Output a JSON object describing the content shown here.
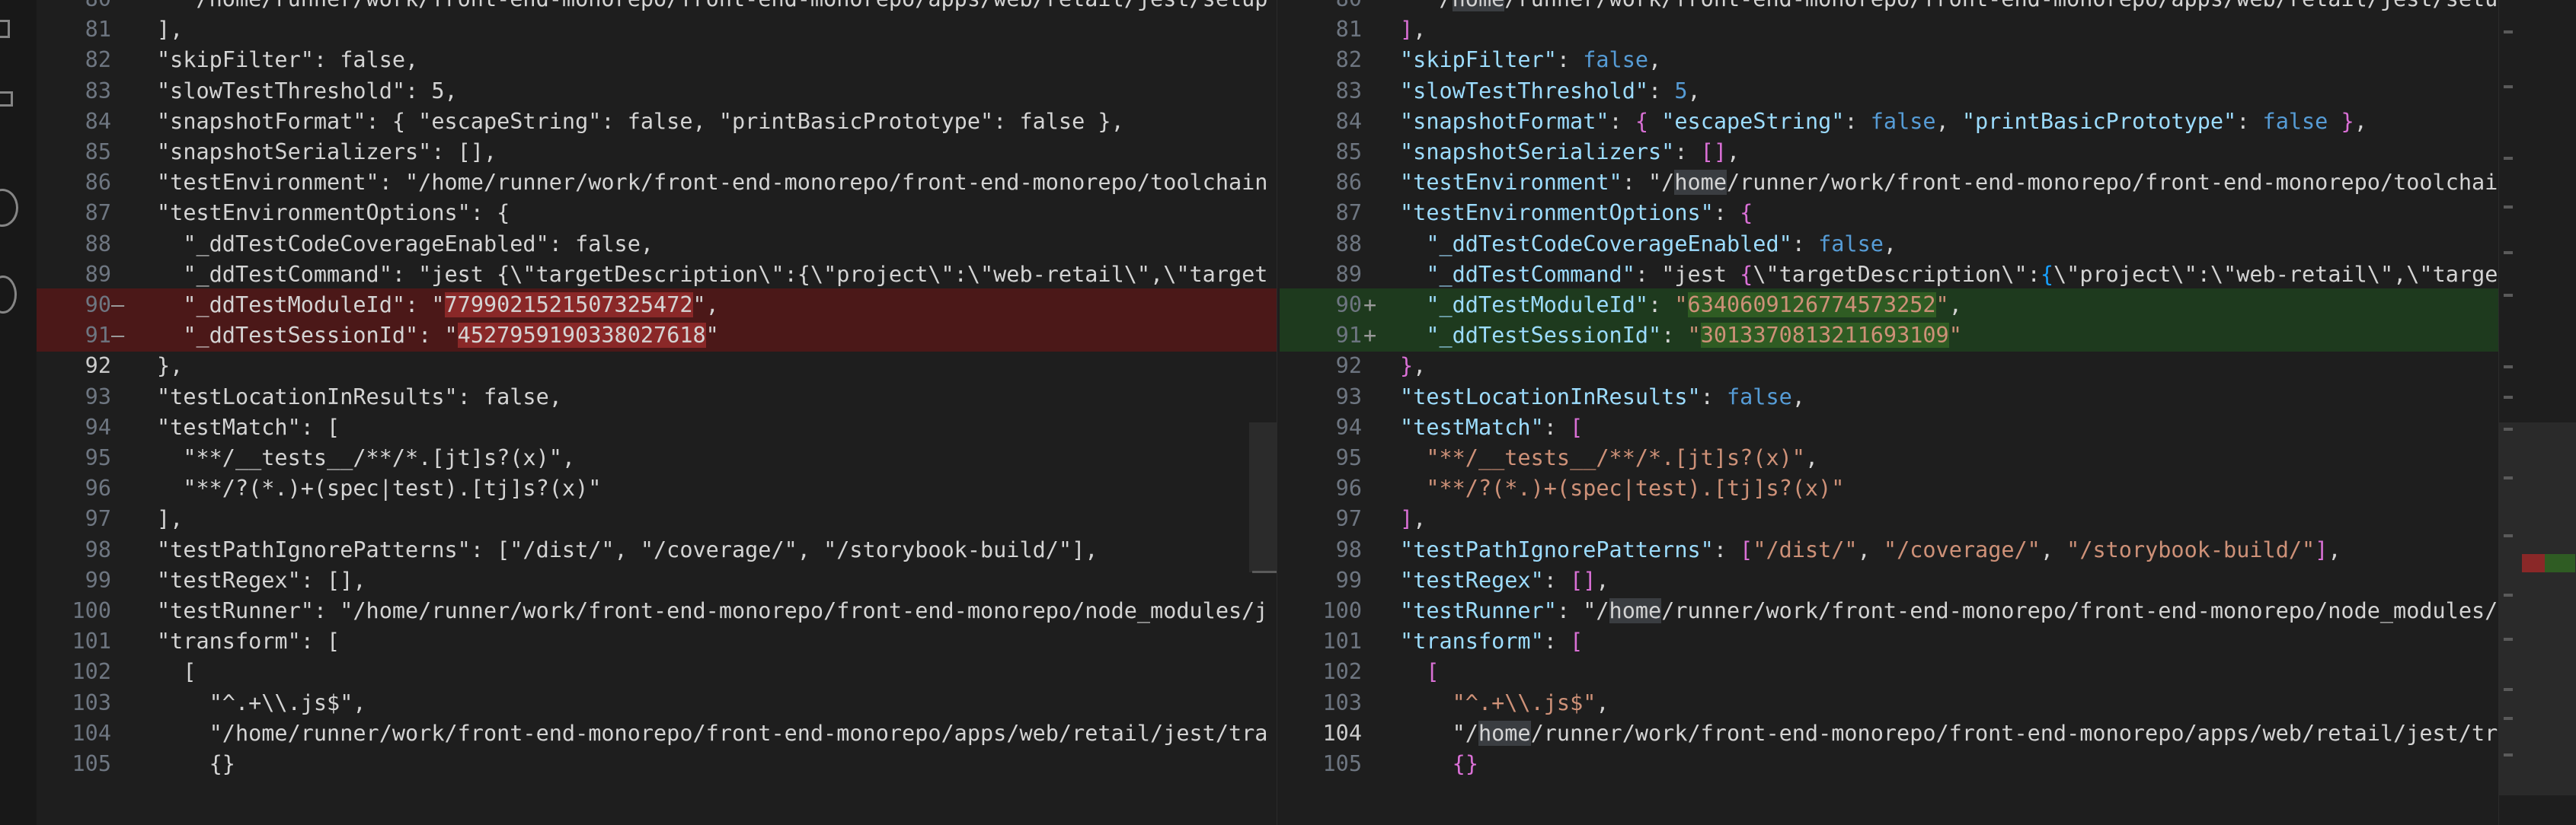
{
  "diff": {
    "left_lines": [
      {
        "num": "80",
        "marker": "",
        "type": "normal",
        "text": "  \"/home/runner/work/front-end-monorepo/front-end-monorepo/apps/web/retail/jest/setup"
      },
      {
        "num": "81",
        "marker": "",
        "type": "normal",
        "text": "],"
      },
      {
        "num": "82",
        "marker": "",
        "type": "normal",
        "text": "\"skipFilter\": false,"
      },
      {
        "num": "83",
        "marker": "",
        "type": "normal",
        "text": "\"slowTestThreshold\": 5,"
      },
      {
        "num": "84",
        "marker": "",
        "type": "normal",
        "text": "\"snapshotFormat\": { \"escapeString\": false, \"printBasicPrototype\": false },"
      },
      {
        "num": "85",
        "marker": "",
        "type": "normal",
        "text": "\"snapshotSerializers\": [],"
      },
      {
        "num": "86",
        "marker": "",
        "type": "normal",
        "text": "\"testEnvironment\": \"/home/runner/work/front-end-monorepo/front-end-monorepo/toolchain"
      },
      {
        "num": "87",
        "marker": "",
        "type": "normal",
        "text": "\"testEnvironmentOptions\": {"
      },
      {
        "num": "88",
        "marker": "",
        "type": "normal",
        "text": "  \"_ddTestCodeCoverageEnabled\": false,"
      },
      {
        "num": "89",
        "marker": "",
        "type": "normal",
        "text": "  \"_ddTestCommand\": \"jest {\\\"targetDescription\\\":{\\\"project\\\":\\\"web-retail\\\",\\\"target"
      },
      {
        "num": "90",
        "marker": "—",
        "type": "removed",
        "text": "  \"_ddTestModuleId\": \"7799021521507325472\","
      },
      {
        "num": "91",
        "marker": "—",
        "type": "removed",
        "text": "  \"_ddTestSessionId\": \"4527959190338027618\""
      },
      {
        "num": "92",
        "marker": "",
        "type": "normal",
        "text": "},"
      },
      {
        "num": "93",
        "marker": "",
        "type": "normal",
        "text": "\"testLocationInResults\": false,"
      },
      {
        "num": "94",
        "marker": "",
        "type": "normal",
        "text": "\"testMatch\": ["
      },
      {
        "num": "95",
        "marker": "",
        "type": "normal",
        "text": "  \"**/__tests__/**/*.[jt]s?(x)\","
      },
      {
        "num": "96",
        "marker": "",
        "type": "normal",
        "text": "  \"**/?(*.)+(spec|test).[tj]s?(x)\""
      },
      {
        "num": "97",
        "marker": "",
        "type": "normal",
        "text": "],"
      },
      {
        "num": "98",
        "marker": "",
        "type": "normal",
        "text": "\"testPathIgnorePatterns\": [\"/dist/\", \"/coverage/\", \"/storybook-build/\"],"
      },
      {
        "num": "99",
        "marker": "",
        "type": "normal",
        "text": "\"testRegex\": [],"
      },
      {
        "num": "100",
        "marker": "",
        "type": "normal",
        "text": "\"testRunner\": \"/home/runner/work/front-end-monorepo/front-end-monorepo/node_modules/j"
      },
      {
        "num": "101",
        "marker": "",
        "type": "normal",
        "text": "\"transform\": ["
      },
      {
        "num": "102",
        "marker": "",
        "type": "normal",
        "text": "  ["
      },
      {
        "num": "103",
        "marker": "",
        "type": "normal",
        "text": "    \"^.+\\\\.js$\","
      },
      {
        "num": "104",
        "marker": "",
        "type": "normal",
        "text": "    \"/home/runner/work/front-end-monorepo/front-end-monorepo/apps/web/retail/jest/tra"
      },
      {
        "num": "105",
        "marker": "",
        "type": "normal",
        "text": "    {}"
      }
    ],
    "right_lines": [
      {
        "num": "80",
        "marker": "",
        "type": "normal",
        "text": "  \"/home/runner/work/front-end-monorepo/front-end-monorepo/apps/web/retail/jest/setup"
      },
      {
        "num": "81",
        "marker": "",
        "type": "normal",
        "text": "],"
      },
      {
        "num": "82",
        "marker": "",
        "type": "normal",
        "text": "\"skipFilter\": false,"
      },
      {
        "num": "83",
        "marker": "",
        "type": "normal",
        "text": "\"slowTestThreshold\": 5,"
      },
      {
        "num": "84",
        "marker": "",
        "type": "normal",
        "text": "\"snapshotFormat\": { \"escapeString\": false, \"printBasicPrototype\": false },"
      },
      {
        "num": "85",
        "marker": "",
        "type": "normal",
        "text": "\"snapshotSerializers\": [],"
      },
      {
        "num": "86",
        "marker": "",
        "type": "normal",
        "text": "\"testEnvironment\": \"/home/runner/work/front-end-monorepo/front-end-monorepo/toolchain"
      },
      {
        "num": "87",
        "marker": "",
        "type": "normal",
        "text": "\"testEnvironmentOptions\": {"
      },
      {
        "num": "88",
        "marker": "",
        "type": "normal",
        "text": "  \"_ddTestCodeCoverageEnabled\": false,"
      },
      {
        "num": "89",
        "marker": "",
        "type": "normal",
        "text": "  \"_ddTestCommand\": \"jest {\\\"targetDescription\\\":{\\\"project\\\":\\\"web-retail\\\",\\\"target"
      },
      {
        "num": "90",
        "marker": "+",
        "type": "added",
        "text": "  \"_ddTestModuleId\": \"6340609126774573252\","
      },
      {
        "num": "91",
        "marker": "+",
        "type": "added",
        "text": "  \"_ddTestSessionId\": \"3013370813211693109\""
      },
      {
        "num": "92",
        "marker": "",
        "type": "normal",
        "text": "},"
      },
      {
        "num": "93",
        "marker": "",
        "type": "normal",
        "text": "\"testLocationInResults\": false,"
      },
      {
        "num": "94",
        "marker": "",
        "type": "normal",
        "text": "\"testMatch\": ["
      },
      {
        "num": "95",
        "marker": "",
        "type": "normal",
        "text": "  \"**/__tests__/**/*.[jt]s?(x)\","
      },
      {
        "num": "96",
        "marker": "",
        "type": "normal",
        "text": "  \"**/?(*.)+(spec|test).[tj]s?(x)\""
      },
      {
        "num": "97",
        "marker": "",
        "type": "normal",
        "text": "],"
      },
      {
        "num": "98",
        "marker": "",
        "type": "normal",
        "text": "\"testPathIgnorePatterns\": [\"/dist/\", \"/coverage/\", \"/storybook-build/\"],"
      },
      {
        "num": "99",
        "marker": "",
        "type": "normal",
        "text": "\"testRegex\": [],"
      },
      {
        "num": "100",
        "marker": "",
        "type": "normal",
        "text": "\"testRunner\": \"/home/runner/work/front-end-monorepo/front-end-monorepo/node_modules/j"
      },
      {
        "num": "101",
        "marker": "",
        "type": "normal",
        "text": "\"transform\": ["
      },
      {
        "num": "102",
        "marker": "",
        "type": "normal",
        "text": "  ["
      },
      {
        "num": "103",
        "marker": "",
        "type": "normal",
        "text": "    \"^.+\\\\.js$\","
      },
      {
        "num": "104",
        "marker": "",
        "type": "normal",
        "text": "    \"/home/runner/work/front-end-monorepo/front-end-monorepo/apps/web/retail/jest/tra"
      },
      {
        "num": "105",
        "marker": "",
        "type": "normal",
        "text": "    {}"
      }
    ],
    "left_active_line": "92",
    "right_active_line": "104",
    "gutter_arrow": "→",
    "highlight": {
      "left_removed_values": [
        "7799021521507325472",
        "4527959190338027618"
      ],
      "right_added_values": [
        "6340609126774573252",
        "3013370813211693109"
      ],
      "right_word": "home"
    }
  },
  "colors": {
    "background": "#1e1e1e",
    "removed_line": "#4b1818",
    "removed_word": "#8a2828",
    "added_line": "#1e3a1e",
    "added_word": "#2f5c23",
    "key": "#9cdcfe",
    "string": "#ce9178",
    "keyword": "#569cd6"
  },
  "activity_bar": {
    "icons": [
      "files-icon",
      "extensions-icon",
      "account-circle-icon",
      "remote-icon"
    ]
  }
}
